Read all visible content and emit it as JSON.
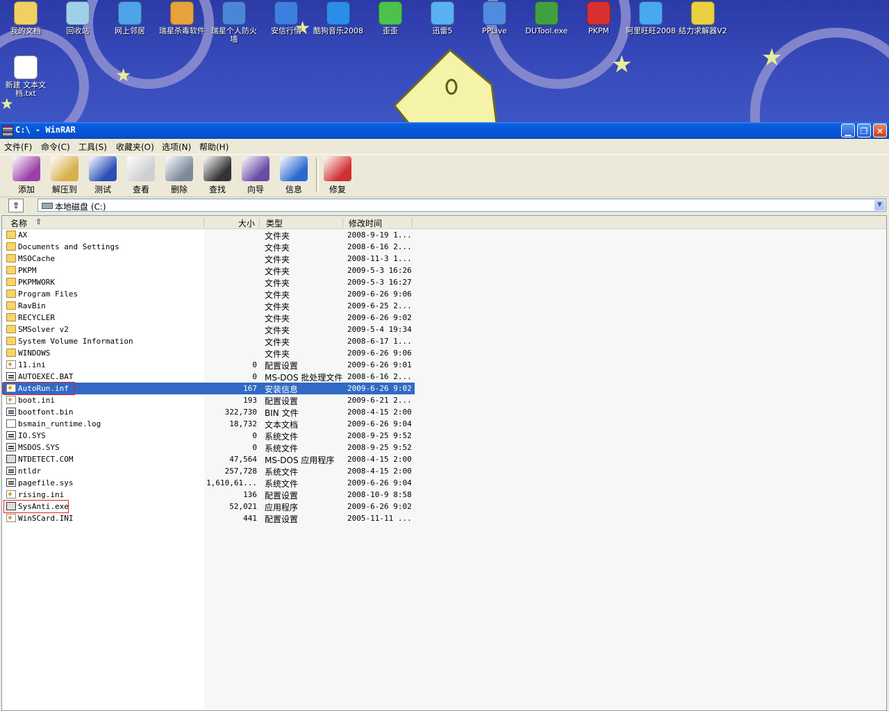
{
  "desktop": {
    "icons": [
      {
        "label": "我的文档",
        "icon": "my-documents-icon",
        "color": "#f0d060"
      },
      {
        "label": "回收站",
        "icon": "recycle-bin-icon",
        "color": "#9fd0ea"
      },
      {
        "label": "网上邻居",
        "icon": "network-icon",
        "color": "#4fa3e8"
      },
      {
        "label": "瑞星杀毒软件",
        "icon": "rising-antivirus-icon",
        "color": "#e8a23a"
      },
      {
        "label": "瑞星个人防火墙",
        "icon": "firewall-icon",
        "color": "#4a86d8"
      },
      {
        "label": "安信行情",
        "icon": "stock-app-icon",
        "color": "#3d7fe0"
      },
      {
        "label": "酷狗音乐2008",
        "icon": "kugou-music-icon",
        "color": "#2a8ee8"
      },
      {
        "label": "歪歪",
        "icon": "yy-icon",
        "color": "#4cc24c"
      },
      {
        "label": "迅雷5",
        "icon": "thunder-icon",
        "color": "#5ab0f0"
      },
      {
        "label": "PPLive",
        "icon": "pplive-icon",
        "color": "#4f8be0"
      },
      {
        "label": "DUTool.exe",
        "icon": "dutool-icon",
        "color": "#3fa040"
      },
      {
        "label": "PKPM",
        "icon": "pkpm-icon",
        "color": "#d83030"
      },
      {
        "label": "阿里旺旺2008",
        "icon": "wangwang-icon",
        "color": "#48a8f0"
      },
      {
        "label": "结力求解器V2",
        "icon": "solver-icon",
        "color": "#e8d040"
      },
      {
        "label": "新建 文本文档.txt",
        "icon": "text-file-icon",
        "color": "#ffffff"
      }
    ]
  },
  "window": {
    "title": "C:\\ - WinRAR",
    "controls": {
      "minimize": "▁",
      "restore": "❐",
      "close": "✕"
    }
  },
  "menu": [
    "文件(F)",
    "命令(C)",
    "工具(S)",
    "收藏夹(O)",
    "选项(N)",
    "帮助(H)"
  ],
  "toolbar": [
    {
      "label": "添加",
      "icon": "add-archive-icon",
      "color": "#9b3fa8"
    },
    {
      "label": "解压到",
      "icon": "extract-icon",
      "color": "#d8b04a"
    },
    {
      "label": "测试",
      "icon": "test-icon",
      "color": "#2a4fb8"
    },
    {
      "label": "查看",
      "icon": "view-icon",
      "color": "#cfcfcf"
    },
    {
      "label": "删除",
      "icon": "delete-icon",
      "color": "#7e8a9a"
    },
    {
      "label": "查找",
      "icon": "find-icon",
      "color": "#333333"
    },
    {
      "label": "向导",
      "icon": "wizard-icon",
      "color": "#6b4aa8"
    },
    {
      "label": "信息",
      "icon": "info-icon",
      "color": "#2a6ad0"
    },
    {
      "label": "修复",
      "icon": "repair-icon",
      "color": "#d03030"
    }
  ],
  "address": {
    "path": "本地磁盘 (C:)"
  },
  "columns": {
    "name": "名称",
    "size": "大小",
    "type": "类型",
    "modified": "修改时间"
  },
  "files": [
    {
      "name": "AX",
      "size": "",
      "type": "文件夹",
      "date": "2008-9-19 1...",
      "kind": "folder"
    },
    {
      "name": "Documents and Settings",
      "size": "",
      "type": "文件夹",
      "date": "2008-6-16 2...",
      "kind": "folder"
    },
    {
      "name": "MSOCache",
      "size": "",
      "type": "文件夹",
      "date": "2008-11-3 1...",
      "kind": "folder"
    },
    {
      "name": "PKPM",
      "size": "",
      "type": "文件夹",
      "date": "2009-5-3 16:26",
      "kind": "folder"
    },
    {
      "name": "PKPMWORK",
      "size": "",
      "type": "文件夹",
      "date": "2009-5-3 16:27",
      "kind": "folder"
    },
    {
      "name": "Program Files",
      "size": "",
      "type": "文件夹",
      "date": "2009-6-26 9:06",
      "kind": "folder"
    },
    {
      "name": "RavBin",
      "size": "",
      "type": "文件夹",
      "date": "2009-6-25 2...",
      "kind": "folder"
    },
    {
      "name": "RECYCLER",
      "size": "",
      "type": "文件夹",
      "date": "2009-6-26 9:02",
      "kind": "folder"
    },
    {
      "name": "SMSolver v2",
      "size": "",
      "type": "文件夹",
      "date": "2009-5-4 19:34",
      "kind": "folder"
    },
    {
      "name": "System Volume Information",
      "size": "",
      "type": "文件夹",
      "date": "2008-6-17 1...",
      "kind": "folder"
    },
    {
      "name": "WINDOWS",
      "size": "",
      "type": "文件夹",
      "date": "2009-6-26 9:06",
      "kind": "folder"
    },
    {
      "name": "11.ini",
      "size": "0",
      "type": "配置设置",
      "date": "2009-6-26 9:01",
      "kind": "cfg"
    },
    {
      "name": "AUTOEXEC.BAT",
      "size": "0",
      "type": "MS-DOS 批处理文件",
      "date": "2008-6-16 2...",
      "kind": "sys"
    },
    {
      "name": "AutoRun.inf",
      "size": "167",
      "type": "安装信息",
      "date": "2009-6-26 9:02",
      "kind": "cfg",
      "selected": true,
      "highlighted": true
    },
    {
      "name": "boot.ini",
      "size": "193",
      "type": "配置设置",
      "date": "2009-6-21 2...",
      "kind": "cfg"
    },
    {
      "name": "bootfont.bin",
      "size": "322,730",
      "type": "BIN 文件",
      "date": "2008-4-15 2:00",
      "kind": "sys"
    },
    {
      "name": "bsmain_runtime.log",
      "size": "18,732",
      "type": "文本文档",
      "date": "2009-6-26 9:04",
      "kind": "txt"
    },
    {
      "name": "IO.SYS",
      "size": "0",
      "type": "系统文件",
      "date": "2008-9-25 9:52",
      "kind": "sys"
    },
    {
      "name": "MSDOS.SYS",
      "size": "0",
      "type": "系统文件",
      "date": "2008-9-25 9:52",
      "kind": "sys"
    },
    {
      "name": "NTDETECT.COM",
      "size": "47,564",
      "type": "MS-DOS 应用程序",
      "date": "2008-4-15 2:00",
      "kind": "exe"
    },
    {
      "name": "ntldr",
      "size": "257,728",
      "type": "系统文件",
      "date": "2008-4-15 2:00",
      "kind": "sys"
    },
    {
      "name": "pagefile.sys",
      "size": "1,610,61...",
      "type": "系统文件",
      "date": "2009-6-26 9:04",
      "kind": "sys"
    },
    {
      "name": "rising.ini",
      "size": "136",
      "type": "配置设置",
      "date": "2008-10-9 8:58",
      "kind": "cfg"
    },
    {
      "name": "SysAnti.exe",
      "size": "52,021",
      "type": "应用程序",
      "date": "2009-6-26 9:02",
      "kind": "exe",
      "highlighted": true
    },
    {
      "name": "WinSCard.INI",
      "size": "441",
      "type": "配置设置",
      "date": "2005-11-11 ...",
      "kind": "cfg"
    }
  ]
}
